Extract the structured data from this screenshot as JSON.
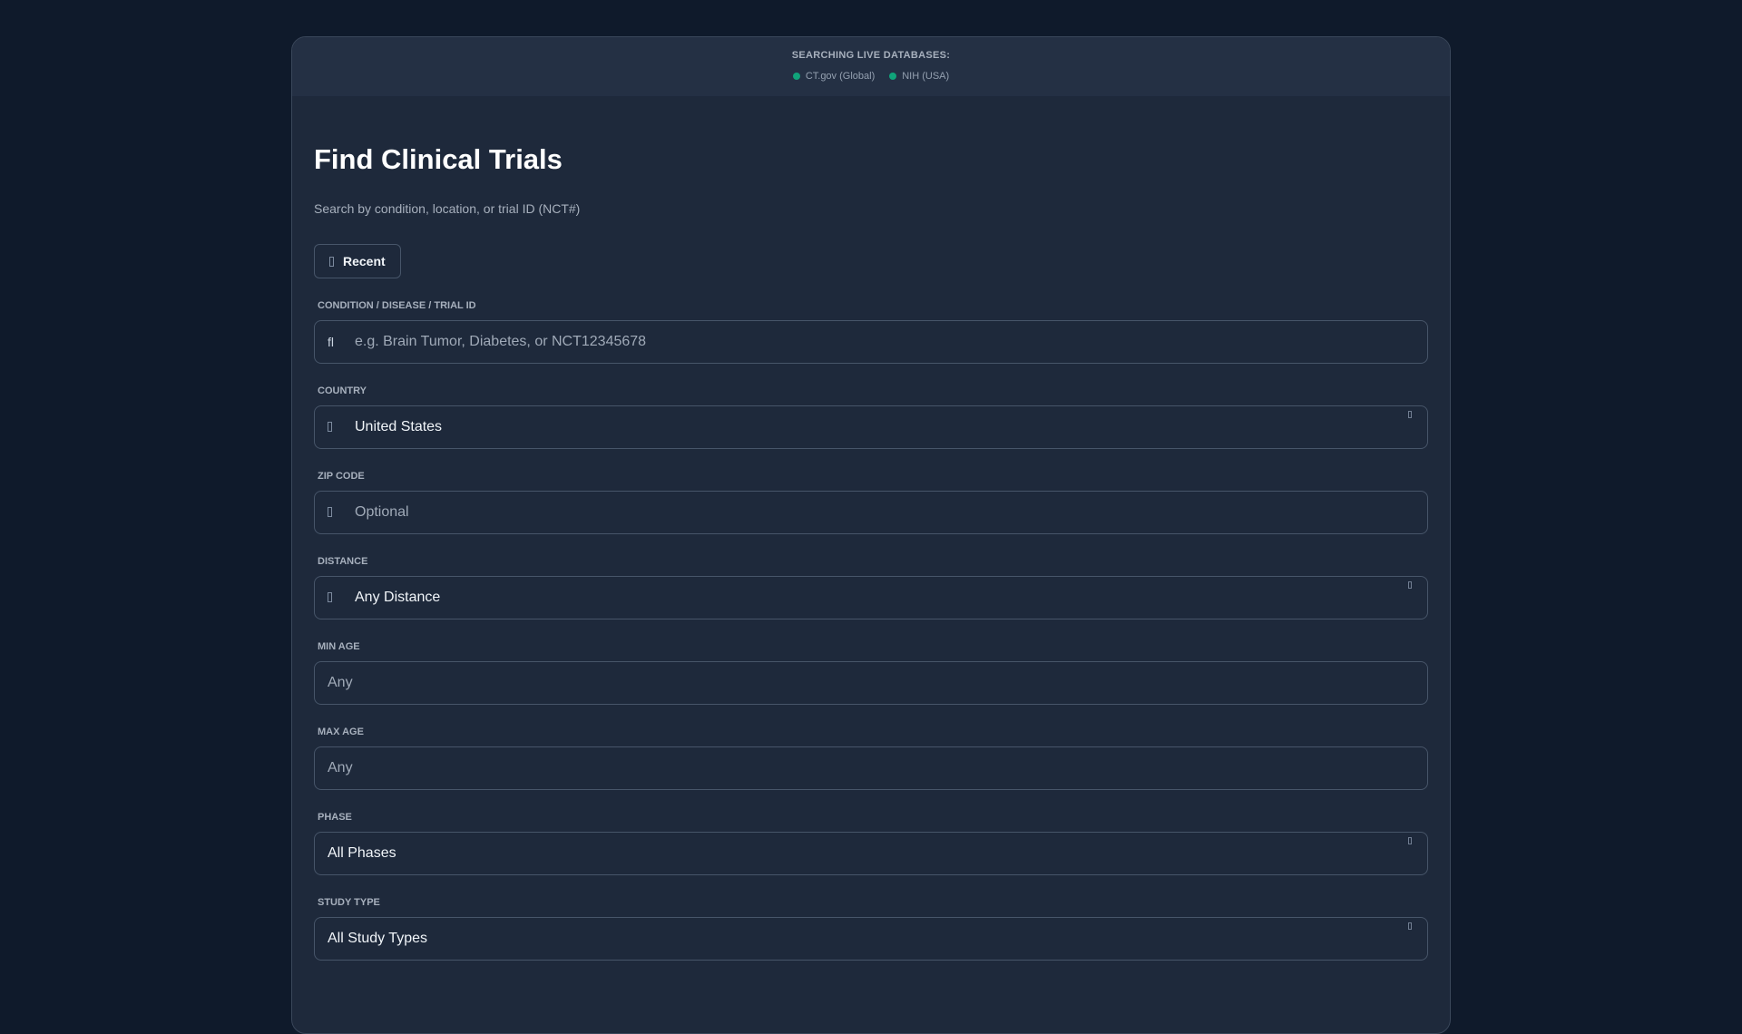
{
  "banner": {
    "title": "SEARCHING LIVE DATABASES:",
    "sources": [
      "CT.gov (Global)",
      "NIH (USA)"
    ],
    "status_color": "#10a37a"
  },
  "header": {
    "title": "Find Clinical Trials",
    "subtitle": "Search by condition, location, or trial ID (NCT#)",
    "recent_label": "Recent"
  },
  "fields": {
    "condition": {
      "label": "CONDITION / DISEASE / TRIAL ID",
      "placeholder": "e.g. Brain Tumor, Diabetes, or NCT12345678",
      "icon": "fl"
    },
    "country": {
      "label": "COUNTRY",
      "value": "United States"
    },
    "zip": {
      "label": "ZIP CODE",
      "placeholder": "Optional"
    },
    "distance": {
      "label": "DISTANCE",
      "value": "Any Distance"
    },
    "min_age": {
      "label": "MIN AGE",
      "placeholder": "Any"
    },
    "max_age": {
      "label": "MAX AGE",
      "placeholder": "Any"
    },
    "phase": {
      "label": "PHASE",
      "value": "All Phases"
    },
    "study_type": {
      "label": "STUDY TYPE",
      "value": "All Study Types"
    }
  }
}
